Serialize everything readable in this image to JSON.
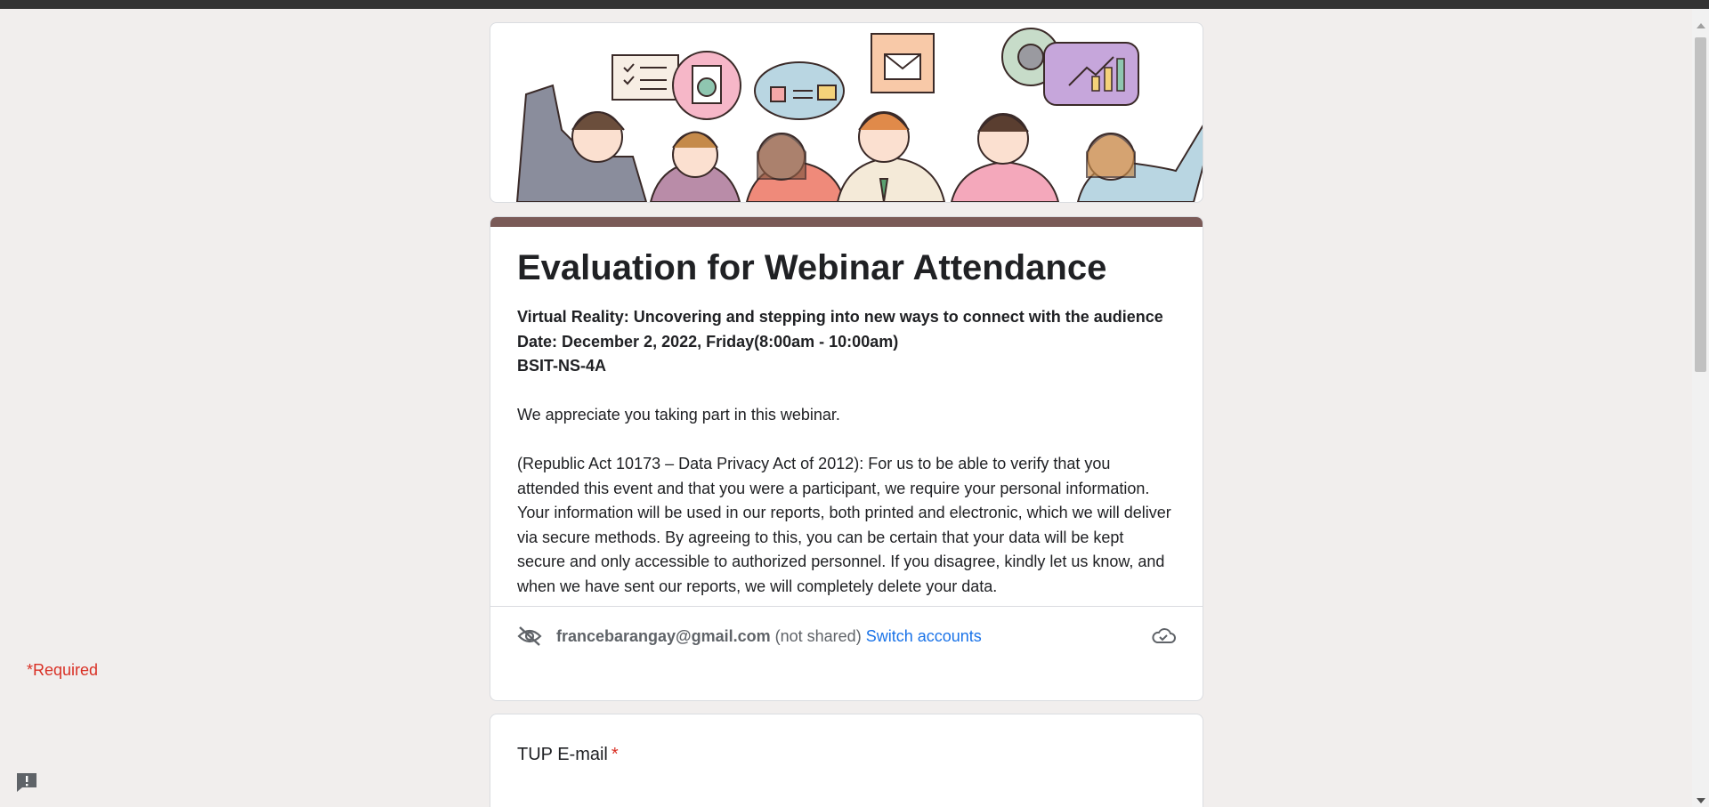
{
  "form": {
    "title": "Evaluation for Webinar Attendance",
    "description": {
      "line1": "Virtual Reality: Uncovering and stepping into new ways to connect with the audience",
      "line2": "Date: December 2, 2022, Friday(8:00am - 10:00am)",
      "line3": "BSIT-NS-4A",
      "para1": "We appreciate you taking part in this webinar.",
      "para2": "(Republic Act 10173 – Data Privacy Act of 2012): For us to be able to verify that you attended this event and that you were a participant, we require your personal information. Your information will be used in our reports, both printed and electronic, which we will deliver via secure methods. By agreeing to this, you can be certain that your data will be kept secure and only accessible to authorized personnel. If you disagree, kindly let us know, and when we have sent our reports, we will completely delete your data."
    },
    "accent_color": "#7a5a57"
  },
  "account": {
    "email": "francebarangay@gmail.com",
    "status": "(not shared)",
    "switch_label": "Switch accounts",
    "icons": [
      "eye-off-icon",
      "cloud-check-icon"
    ]
  },
  "required_note": "*Required",
  "questions": [
    {
      "label": "TUP E-mail",
      "required_mark": "*"
    }
  ],
  "colors": {
    "background": "#f1eeed",
    "link": "#1a73e8",
    "required": "#d93025"
  }
}
